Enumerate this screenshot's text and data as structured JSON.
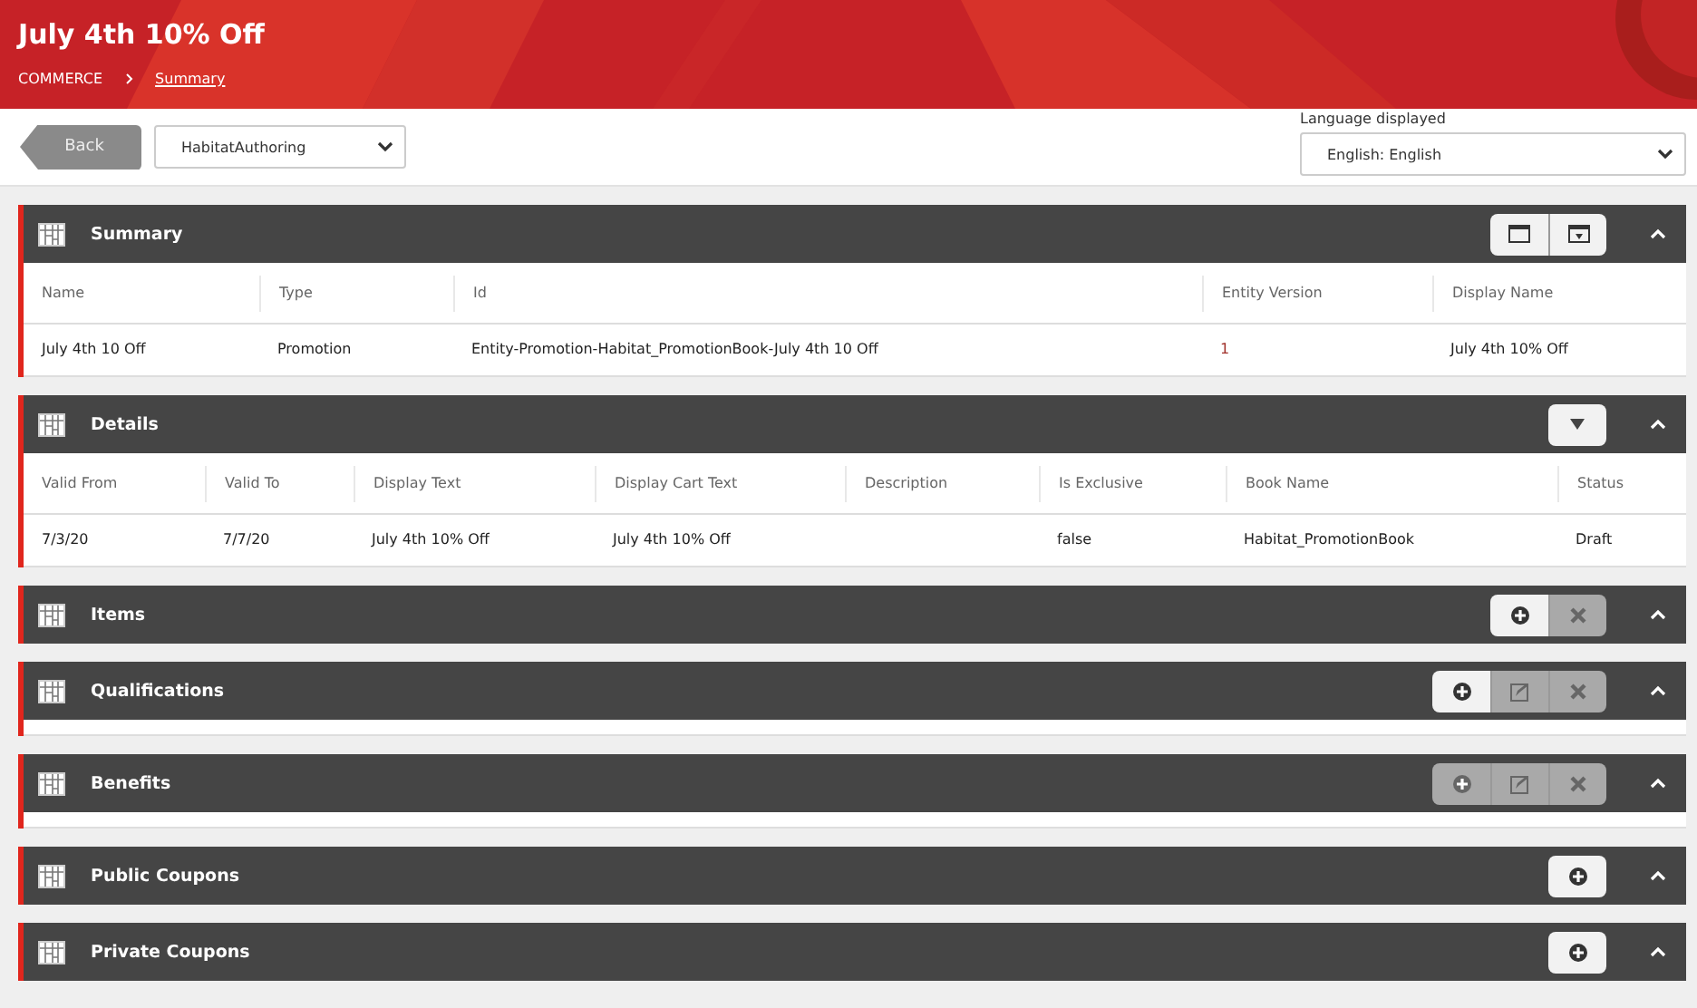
{
  "header": {
    "title": "July 4th 10% Off",
    "breadcrumb": [
      {
        "label": "COMMERCE",
        "kind": "plain"
      },
      {
        "label": "Summary",
        "kind": "link"
      }
    ]
  },
  "toolbar": {
    "back": "Back",
    "database": "HabitatAuthoring",
    "language_label": "Language displayed",
    "language": "English: English"
  },
  "sections": [
    {
      "title": "Summary",
      "expanded": true,
      "kind": "table",
      "actions": [
        {
          "kind": "window",
          "disabled": false
        },
        {
          "kind": "dock",
          "disabled": false
        }
      ],
      "columns": [
        "Name",
        "Type",
        "Id",
        "Entity Version",
        "Display Name"
      ],
      "rows": [
        [
          {
            "text": "July 4th 10 Off"
          },
          {
            "text": "Promotion"
          },
          {
            "text": "Entity-Promotion-Habitat_PromotionBook-July 4th 10 Off"
          },
          {
            "text": "1",
            "color": "#a0302a"
          },
          {
            "text": "July 4th 10% Off"
          }
        ]
      ]
    },
    {
      "title": "Details",
      "expanded": true,
      "kind": "table",
      "actions": [
        {
          "kind": "dropdown",
          "disabled": false
        }
      ],
      "columns": [
        "Valid From",
        "Valid To",
        "Display Text",
        "Display Cart Text",
        "Description",
        "Is Exclusive",
        "Book Name",
        "Status"
      ],
      "rows": [
        [
          {
            "text": "7/3/20"
          },
          {
            "text": "7/7/20"
          },
          {
            "text": "July 4th 10% Off"
          },
          {
            "text": "July 4th 10% Off"
          },
          {
            "text": ""
          },
          {
            "text": "false"
          },
          {
            "text": "Habitat_PromotionBook"
          },
          {
            "text": "Draft"
          }
        ]
      ]
    },
    {
      "title": "Items",
      "expanded": true,
      "kind": "none",
      "actions": [
        {
          "kind": "add",
          "disabled": false
        },
        {
          "kind": "remove",
          "disabled": true
        }
      ]
    },
    {
      "title": "Qualifications",
      "expanded": true,
      "kind": "blank",
      "actions": [
        {
          "kind": "add",
          "disabled": false
        },
        {
          "kind": "edit",
          "disabled": true
        },
        {
          "kind": "remove",
          "disabled": true
        }
      ]
    },
    {
      "title": "Benefits",
      "expanded": true,
      "kind": "blank",
      "actions": [
        {
          "kind": "add",
          "disabled": true
        },
        {
          "kind": "edit",
          "disabled": true
        },
        {
          "kind": "remove",
          "disabled": true
        }
      ]
    },
    {
      "title": "Public Coupons",
      "expanded": true,
      "kind": "none",
      "actions": [
        {
          "kind": "add",
          "disabled": false
        }
      ]
    },
    {
      "title": "Private Coupons",
      "expanded": true,
      "kind": "none",
      "actions": [
        {
          "kind": "add",
          "disabled": false
        }
      ]
    }
  ]
}
